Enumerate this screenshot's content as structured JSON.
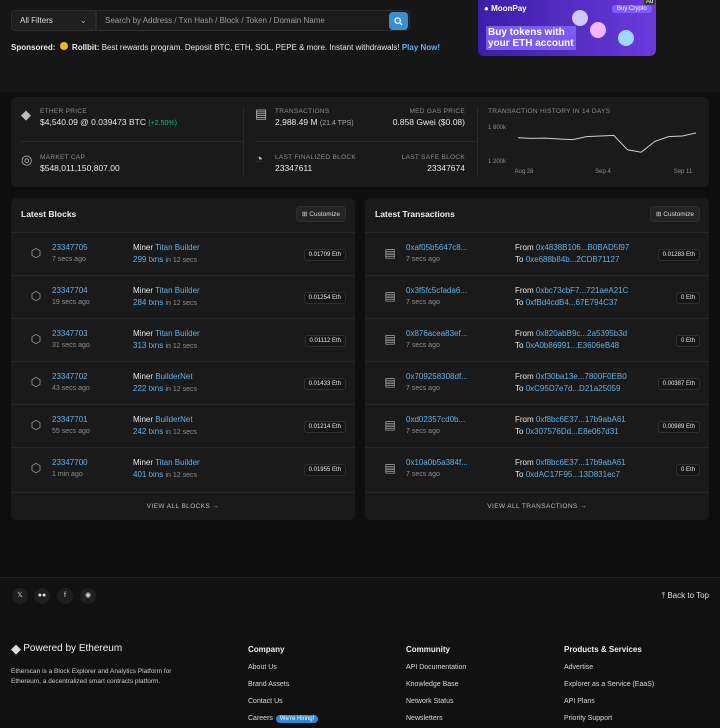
{
  "search": {
    "filter": "All Filters",
    "placeholder": "Search by Address / Txn Hash / Block / Token / Domain Name"
  },
  "sponsor": {
    "label": "Sponsored:",
    "brand": "Rollbit:",
    "text": "Best rewards program. Deposit BTC, ETH, SOL, PEPE & more. Instant withdrawals!",
    "link": "Play Now!"
  },
  "ad": {
    "brand": "MoonPay",
    "headline1": "Buy tokens with",
    "headline2": "your ETH account",
    "button": "Buy Crypto",
    "tag": "Ad"
  },
  "stats": {
    "ether_price_label": "ETHER PRICE",
    "ether_price": "$4,540.09 @ 0.039473 BTC",
    "ether_change": "(+2.50%)",
    "market_cap_label": "MARKET CAP",
    "market_cap": "$548,011,150,807.00",
    "transactions_label": "TRANSACTIONS",
    "transactions": "2,988.49 M",
    "tps": "(21.4 TPS)",
    "gas_label": "MED GAS PRICE",
    "gas": "0.858 Gwei ($0.08)",
    "finalized_label": "LAST FINALIZED BLOCK",
    "finalized": "23347611",
    "safe_label": "LAST SAFE BLOCK",
    "safe": "23347674",
    "history_label": "TRANSACTION HISTORY IN 14 DAYS"
  },
  "chart_data": {
    "type": "line",
    "title": "TRANSACTION HISTORY IN 14 DAYS",
    "y_ticks": [
      "1 800k",
      "1 200k"
    ],
    "x_ticks": [
      "Aug 28",
      "Sep 4",
      "Sep 11"
    ],
    "ylim": [
      1200000,
      1800000
    ],
    "values": [
      1620000,
      1610000,
      1615000,
      1600000,
      1590000,
      1640000,
      1650000,
      1660000,
      1420000,
      1380000,
      1560000,
      1640000,
      1650000,
      1700000
    ]
  },
  "blocks": {
    "title": "Latest Blocks",
    "customize": "Customize",
    "view_all": "VIEW ALL BLOCKS →",
    "items": [
      {
        "num": "23347705",
        "age": "7 secs ago",
        "miner_label": "Miner",
        "miner": "Titan Builder",
        "txns": "299 txns",
        "time": "in 12 secs",
        "amount": "0.01709 Eth"
      },
      {
        "num": "23347704",
        "age": "19 secs ago",
        "miner_label": "Miner",
        "miner": "Titan Builder",
        "txns": "284 txns",
        "time": "in 12 secs",
        "amount": "0.01254 Eth"
      },
      {
        "num": "23347703",
        "age": "31 secs ago",
        "miner_label": "Miner",
        "miner": "Titan Builder",
        "txns": "313 txns",
        "time": "in 12 secs",
        "amount": "0.01112 Eth"
      },
      {
        "num": "23347702",
        "age": "43 secs ago",
        "miner_label": "Miner",
        "miner": "BuilderNet",
        "txns": "222 txns",
        "time": "in 12 secs",
        "amount": "0.01433 Eth"
      },
      {
        "num": "23347701",
        "age": "55 secs ago",
        "miner_label": "Miner",
        "miner": "BuilderNet",
        "txns": "242 txns",
        "time": "in 12 secs",
        "amount": "0.01214 Eth"
      },
      {
        "num": "23347700",
        "age": "1 min ago",
        "miner_label": "Miner",
        "miner": "Titan Builder",
        "txns": "401 txns",
        "time": "in 12 secs",
        "amount": "0.01955 Eth"
      }
    ]
  },
  "txs": {
    "title": "Latest Transactions",
    "customize": "Customize",
    "view_all": "VIEW ALL TRANSACTIONS →",
    "items": [
      {
        "hash": "0xaf05b5647c8...",
        "age": "7 secs ago",
        "from": "0x4838B106...B0BAD5f97",
        "to": "0xe688b84b...2CDB71127",
        "amount": "0.01283 Eth"
      },
      {
        "hash": "0x3f5fc5cfada6...",
        "age": "7 secs ago",
        "from": "0xbc73cbF7...721aeA21C",
        "to": "0xfBd4cdB4...67E794C37",
        "amount": "0 Eth"
      },
      {
        "hash": "0x876acea83ef...",
        "age": "7 secs ago",
        "from": "0x820abB9c...2a5395b3d",
        "to": "0xA0b86991...E3606eB48",
        "amount": "0 Eth"
      },
      {
        "hash": "0x709258308df...",
        "age": "7 secs ago",
        "from": "0xf30ba13e...7800F0EB0",
        "to": "0xC95D7e7d...D21a25059",
        "amount": "0.00387 Eth"
      },
      {
        "hash": "0xd02357cd0b...",
        "age": "7 secs ago",
        "from": "0xf8bc6E37...17b9abA61",
        "to": "0x307576Dd...E8e067d31",
        "amount": "0.00989 Eth"
      },
      {
        "hash": "0x10a0b5a384f...",
        "age": "7 secs ago",
        "from": "0xf8bc6E37...17b9abA61",
        "to": "0xdAC17F95...13D831ec7",
        "amount": "0 Eth"
      }
    ],
    "from_label": "From",
    "to_label": "To"
  },
  "footer": {
    "back_to_top": "Back to Top",
    "powered": "Powered by Ethereum",
    "desc1": "Etherscan is a Block Explorer and Analytics Platform for",
    "desc2": "Ethereum, a decentralized smart contracts platform.",
    "company": {
      "title": "Company",
      "items": [
        "About Us",
        "Brand Assets",
        "Contact Us",
        "Careers"
      ],
      "hiring": "We're Hiring!"
    },
    "community": {
      "title": "Community",
      "items": [
        "API Documentation",
        "Knowledge Base",
        "Network Status",
        "Newsletters"
      ]
    },
    "products": {
      "title": "Products & Services",
      "items": [
        "Advertise",
        "Explorer as a Service (EaaS)",
        "API Plans",
        "Priority Support"
      ]
    }
  }
}
